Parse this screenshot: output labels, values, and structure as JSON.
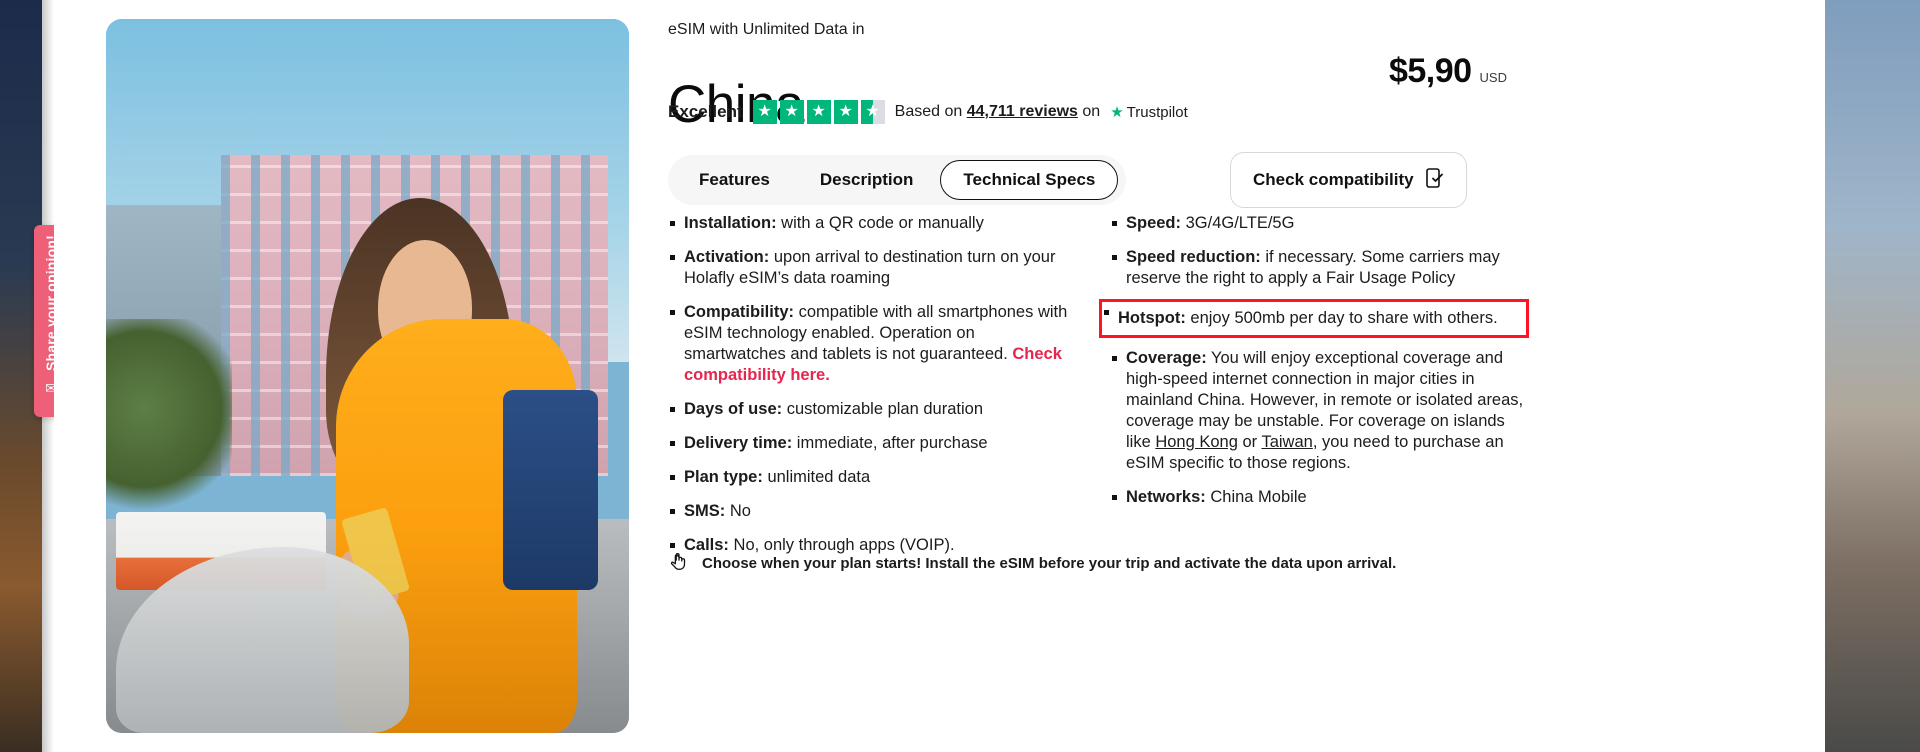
{
  "opinion_tab": {
    "label": "Share your opinion!",
    "icon": "feedback-icon"
  },
  "product": {
    "eyebrow": "eSIM with Unlimited Data in",
    "title": "China",
    "price": "$5,90",
    "currency": "USD"
  },
  "rating": {
    "label": "Excellent",
    "stars_filled": 4,
    "stars_half": 1,
    "stars_total": 5,
    "based_on_prefix": "Based on",
    "reviews_count": "44,711 reviews",
    "on_text": "on",
    "brand": "Trustpilot",
    "brand_color": "#00b67a",
    "star_icon": "star-icon"
  },
  "tabs": [
    {
      "label": "Features",
      "active": false
    },
    {
      "label": "Description",
      "active": false
    },
    {
      "label": "Technical Specs",
      "active": true
    }
  ],
  "compat_button": {
    "label": "Check compatibility",
    "icon": "device-check-icon"
  },
  "specs": {
    "left": [
      {
        "key": "Installation:",
        "value": " with a QR code or manually"
      },
      {
        "key": "Activation:",
        "value": " upon arrival to destination turn on your Holafly eSIM’s data roaming"
      },
      {
        "key": "Compatibility:",
        "value": " compatible with all smartphones with eSIM technology enabled. Operation on smartwatches and tablets is not guaranteed. ",
        "link": "Check compatibility here."
      },
      {
        "key": "Days of use:",
        "value": " customizable plan duration"
      },
      {
        "key": "Delivery time:",
        "value": " immediate, after purchase"
      },
      {
        "key": "Plan type:",
        "value": " unlimited data"
      },
      {
        "key": "SMS:",
        "value": " No"
      },
      {
        "key": "Calls:",
        "value": " No, only through apps (VOIP)."
      }
    ],
    "right": [
      {
        "key": "Speed:",
        "value": " 3G/4G/LTE/5G"
      },
      {
        "key": "Speed reduction:",
        "value": " if necessary. Some carriers may reserve the right to apply a Fair Usage Policy"
      },
      {
        "key": "Hotspot:",
        "value": " enjoy 500mb per day to share with others.",
        "highlighted": true
      },
      {
        "key": "Coverage:",
        "value": " You will enjoy exceptional coverage and high-speed internet connection in major cities in mainland China. However, in remote or isolated areas, coverage may be unstable. For coverage on islands like ",
        "link1": "Hong Kong",
        "mid": " or ",
        "link2": "Taiwan",
        "tail": ", you need to purchase an eSIM specific to those regions."
      },
      {
        "key": "Networks:",
        "value": " China Mobile"
      }
    ]
  },
  "footer_note": {
    "icon": "hand-tap-icon",
    "text": "Choose when your plan starts! Install the eSIM before your trip and activate the data upon arrival."
  },
  "colors": {
    "accent_red": "#e8254e",
    "highlight_red": "#ff1423",
    "trustpilot_green": "#00b67a",
    "opinion_pink": "#ee5f78"
  }
}
